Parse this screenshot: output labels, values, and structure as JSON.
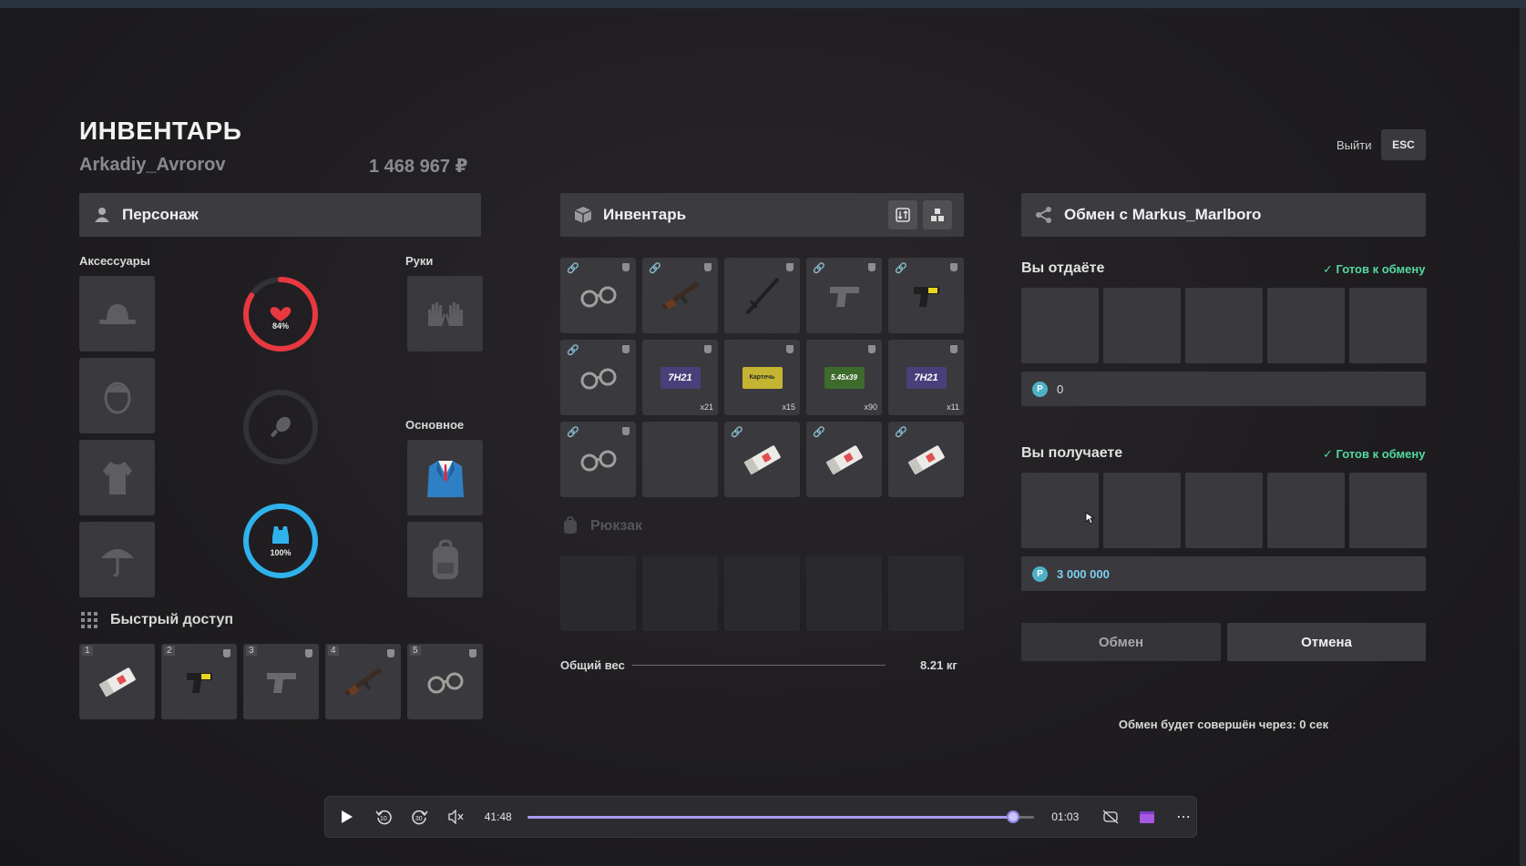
{
  "header": {
    "title": "ИНВЕНТАРЬ",
    "player_name": "Arkadiy_Avrorov",
    "money": "1 468 967 ₽",
    "exit_label": "Выйти",
    "esc_label": "ESC"
  },
  "character": {
    "panel_title": "Персонаж",
    "accessories_label": "Аксессуары",
    "hands_label": "Руки",
    "main_label": "Основное",
    "health_value": "84%",
    "health_level": 0.84,
    "armor_value": "100%",
    "armor_level": 1.0
  },
  "quick_access": {
    "title": "Быстрый доступ",
    "slots": [
      {
        "num": "1",
        "icon": "medkit-icon"
      },
      {
        "num": "2",
        "icon": "taser-icon"
      },
      {
        "num": "3",
        "icon": "pistol-icon"
      },
      {
        "num": "4",
        "icon": "rifle-icon"
      },
      {
        "num": "5",
        "icon": "handcuffs-icon"
      }
    ]
  },
  "inventory": {
    "panel_title": "Инвентарь",
    "backpack_label": "Рюкзак",
    "weight_label": "Общий вес",
    "weight_value": "8.21 кг",
    "items": [
      {
        "icon": "handcuffs-icon",
        "count": ""
      },
      {
        "icon": "rifle-icon",
        "count": ""
      },
      {
        "icon": "baton-icon",
        "count": ""
      },
      {
        "icon": "pistol-icon",
        "count": ""
      },
      {
        "icon": "taser-icon",
        "count": ""
      },
      {
        "icon": "handcuffs-icon",
        "count": ""
      },
      {
        "icon": "ammo-box-icon",
        "label": "7H21",
        "count": "x21"
      },
      {
        "icon": "ammo-box-icon",
        "label": "Картечь",
        "count": "x15"
      },
      {
        "icon": "ammo-box-icon",
        "label": "5.45x39",
        "count": "x90"
      },
      {
        "icon": "ammo-box-icon",
        "label": "7H21",
        "count": "x11"
      },
      {
        "icon": "handcuffs-icon",
        "count": ""
      },
      {
        "icon": "",
        "count": ""
      },
      {
        "icon": "medkit-icon",
        "count": ""
      },
      {
        "icon": "medkit-icon",
        "count": ""
      },
      {
        "icon": "medkit-icon",
        "count": ""
      }
    ]
  },
  "trade": {
    "panel_title": "Обмен с Markus_Marlboro",
    "give_title": "Вы отдаёте",
    "receive_title": "Вы получаете",
    "ready_label": "Готов к обмену",
    "give_money": "0",
    "receive_money": "3 000 000",
    "coin_symbol": "P",
    "exchange_button": "Обмен",
    "cancel_button": "Отмена",
    "countdown_text": "Обмен будет совершён через: 0 сек"
  },
  "media_player": {
    "current_time": "41:48",
    "remaining_time": "01:03",
    "skip_back": "10",
    "skip_forward": "30",
    "progress": 0.96
  },
  "colors": {
    "health": "#e8383f",
    "armor": "#2fb2ec",
    "ready": "#54d9a0",
    "coin": "#4fb0c6",
    "progress": "#a69cf0"
  }
}
